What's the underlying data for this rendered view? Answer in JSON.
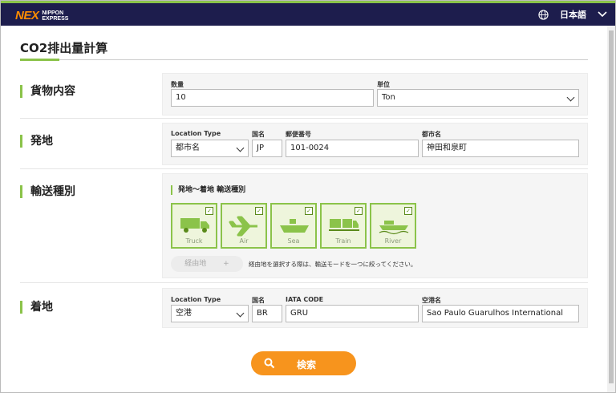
{
  "header": {
    "brand_mark": "NEX",
    "brand_line1": "NIPPON",
    "brand_line2": "EXPRESS",
    "language": "日本語",
    "accent_color": "#8bc34a",
    "bg_color": "#1d1d4d"
  },
  "page": {
    "title": "CO2排出量計算"
  },
  "cargo": {
    "section_label": "貨物内容",
    "quantity_label": "数量",
    "quantity_value": "10",
    "unit_label": "単位",
    "unit_value": "Ton"
  },
  "origin": {
    "section_label": "発地",
    "location_type_label": "Location Type",
    "location_type_value": "都市名",
    "country_label": "国名",
    "country_value": "JP",
    "postal_label": "郵便番号",
    "postal_value": "101-0024",
    "city_label": "都市名",
    "city_value": "神田和泉町"
  },
  "transport": {
    "section_label": "輸送種別",
    "sub_title": "発地〜着地 輸送種別",
    "modes": [
      {
        "label": "Truck",
        "icon": "truck-icon"
      },
      {
        "label": "Air",
        "icon": "airplane-icon"
      },
      {
        "label": "Sea",
        "icon": "ship-icon"
      },
      {
        "label": "Train",
        "icon": "train-icon"
      },
      {
        "label": "River",
        "icon": "river-boat-icon"
      }
    ],
    "via_button_label": "経由地",
    "via_note": "経由地を選択する際は、輸送モードを一つに絞ってください。"
  },
  "destination": {
    "section_label": "着地",
    "location_type_label": "Location Type",
    "location_type_value": "空港",
    "country_label": "国名",
    "country_value": "BR",
    "iata_label": "IATA CODE",
    "iata_value": "GRU",
    "airport_label": "空港名",
    "airport_value": "Sao Paulo Guarulhos International"
  },
  "search": {
    "button_label": "検索",
    "color": "#f7941d"
  }
}
